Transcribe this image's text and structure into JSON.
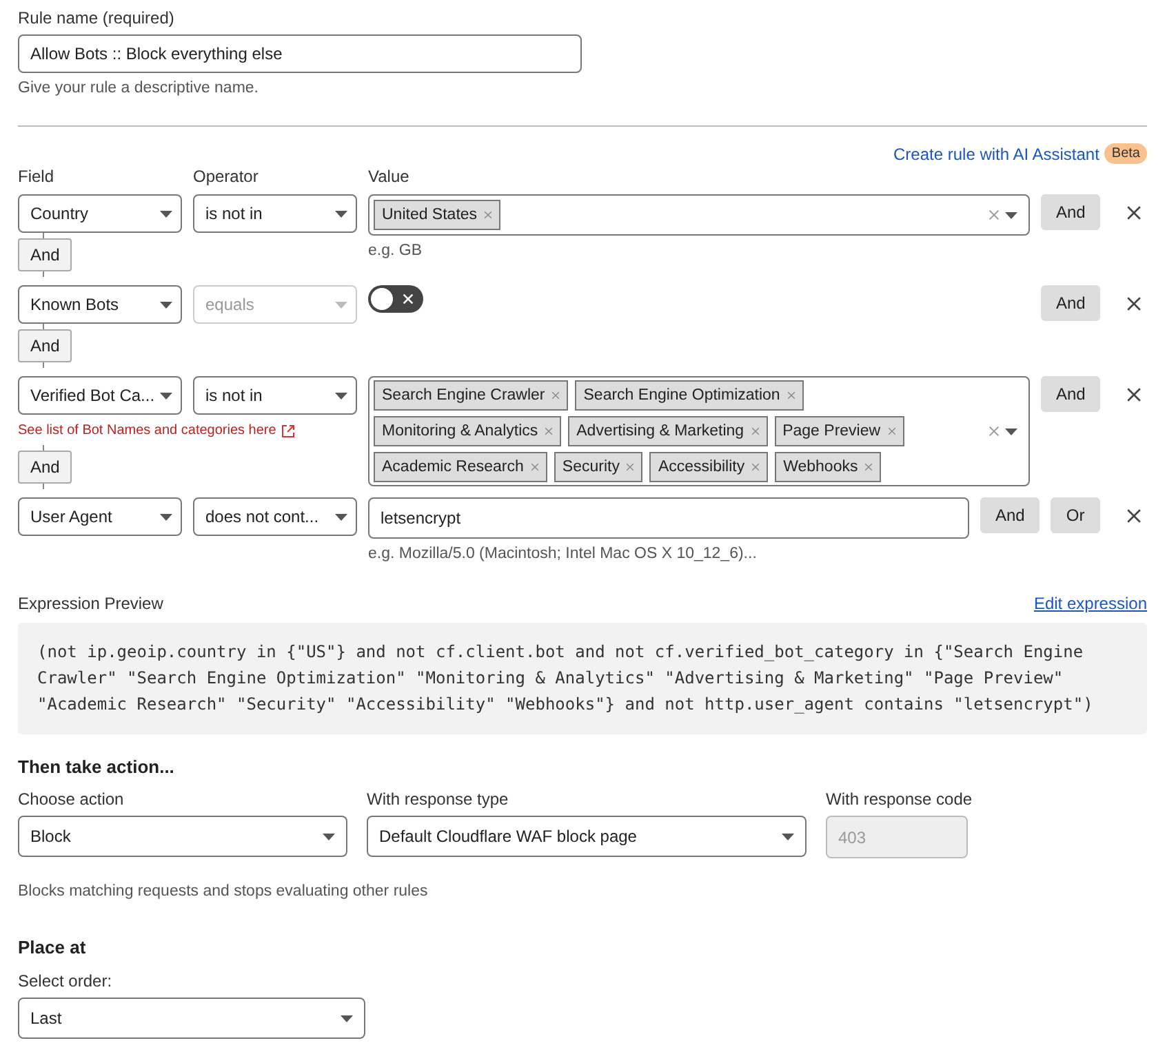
{
  "rule_name": {
    "label": "Rule name (required)",
    "value": "Allow Bots :: Block everything else",
    "hint": "Give your rule a descriptive name."
  },
  "ai_assistant": {
    "link": "Create rule with AI Assistant",
    "badge": "Beta"
  },
  "conditions": {
    "columns": [
      "Field",
      "Operator",
      "Value"
    ],
    "rows": [
      {
        "field": "Country",
        "operator": {
          "value": "is not in",
          "disabled": false
        },
        "kind": "tags",
        "tags": [
          "United States"
        ],
        "hint": "e.g. GB",
        "actions": [
          "And"
        ],
        "connector": "And"
      },
      {
        "field": "Known Bots",
        "operator": {
          "value": "equals",
          "disabled": true
        },
        "kind": "toggle",
        "on": false,
        "actions": [
          "And"
        ],
        "connector": "And"
      },
      {
        "field": "Verified Bot Ca...",
        "operator": {
          "value": "is not in",
          "disabled": false
        },
        "kind": "tags",
        "tags": [
          "Search Engine Crawler",
          "Search Engine Optimization",
          "Monitoring & Analytics",
          "Advertising & Marketing",
          "Page Preview",
          "Academic Research",
          "Security",
          "Accessibility",
          "Webhooks"
        ],
        "link": "See list of Bot Names and categories here",
        "actions": [
          "And"
        ],
        "connector": "And"
      },
      {
        "field": "User Agent",
        "operator": {
          "value": "does not cont...",
          "disabled": false
        },
        "kind": "text",
        "value": "letsencrypt",
        "hint": "e.g. Mozilla/5.0 (Macintosh; Intel Mac OS X 10_12_6)...",
        "actions": [
          "And",
          "Or"
        ]
      }
    ]
  },
  "expression": {
    "label": "Expression Preview",
    "edit_link": "Edit expression",
    "text": "(not ip.geoip.country in {\"US\"} and not cf.client.bot and not cf.verified_bot_category in {\"Search Engine Crawler\" \"Search Engine Optimization\" \"Monitoring & Analytics\" \"Advertising & Marketing\" \"Page Preview\" \"Academic Research\" \"Security\" \"Accessibility\" \"Webhooks\"} and not http.user_agent contains \"letsencrypt\")"
  },
  "action": {
    "heading": "Then take action...",
    "fields": [
      {
        "label": "Choose action",
        "kind": "select",
        "value": "Block",
        "disabled": false
      },
      {
        "label": "With response type",
        "kind": "select",
        "value": "Default Cloudflare WAF block page",
        "disabled": false
      },
      {
        "label": "With response code",
        "kind": "input",
        "value": "403",
        "disabled": true
      }
    ],
    "description": "Blocks matching requests and stops evaluating other rules"
  },
  "placement": {
    "heading": "Place at",
    "label": "Select order:",
    "value": "Last"
  }
}
